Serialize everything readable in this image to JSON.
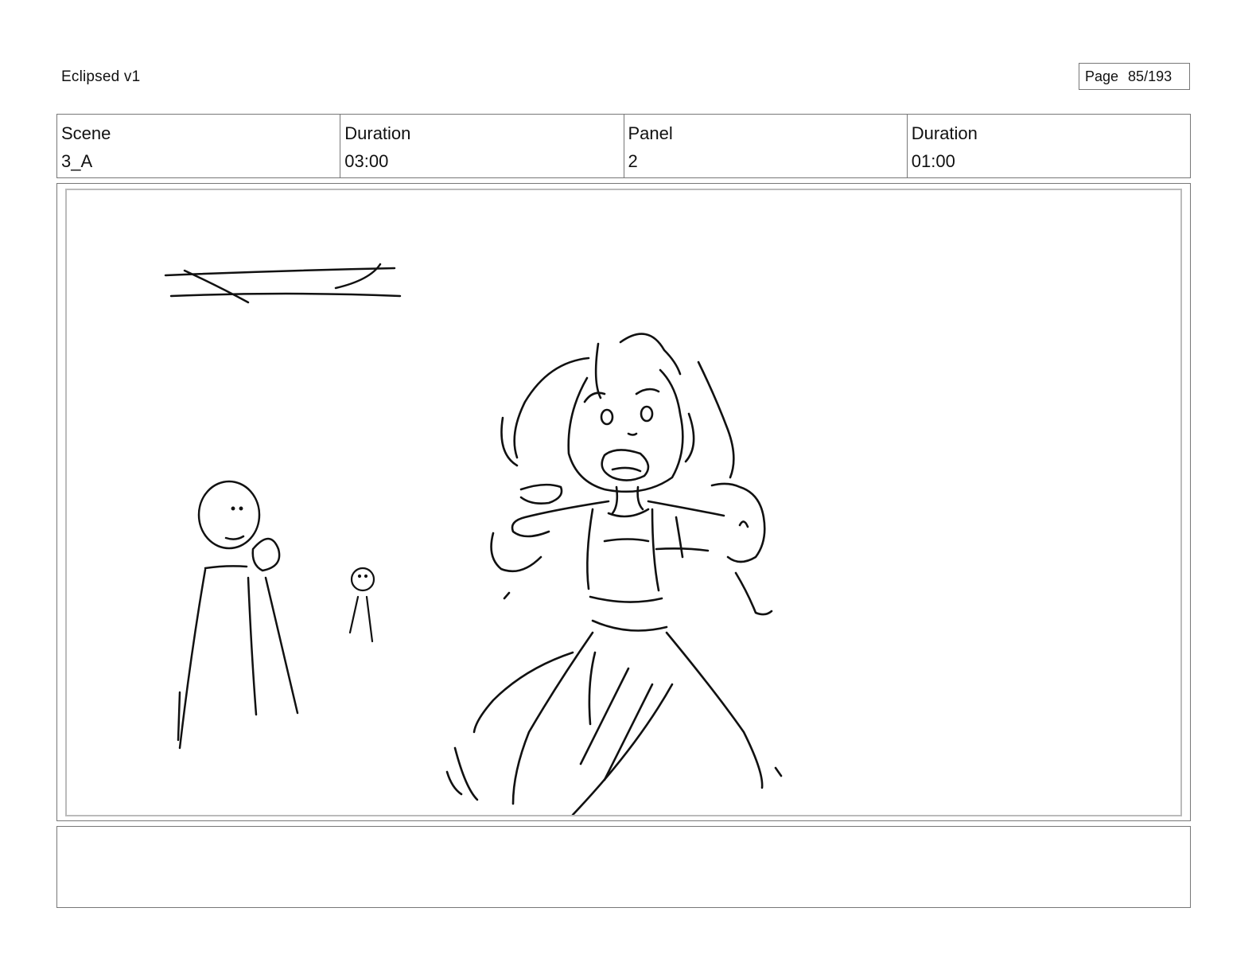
{
  "header": {
    "doc_title": "Eclipsed v1",
    "page_label": "Page",
    "page_number": "85/193"
  },
  "info": [
    {
      "label": "Scene",
      "value": "3_A"
    },
    {
      "label": "Duration",
      "value": "03:00"
    },
    {
      "label": "Panel",
      "value": "2"
    },
    {
      "label": "Duration",
      "value": "01:00"
    }
  ],
  "notes": ""
}
